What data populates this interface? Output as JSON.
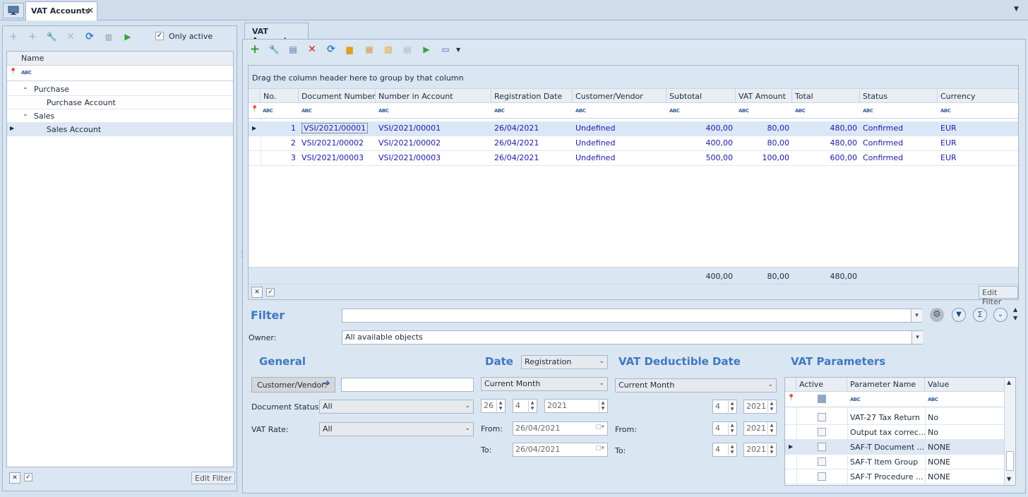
{
  "window": {
    "tab_title": "VAT Accounts"
  },
  "left": {
    "only_active_label": "Only active",
    "only_active_checked": true,
    "column_name": "Name",
    "tree": [
      {
        "label": "Purchase",
        "level": 0
      },
      {
        "label": "Purchase Account",
        "level": 1
      },
      {
        "label": "Sales",
        "level": 0
      },
      {
        "label": "Sales Account",
        "level": 1,
        "selected": true
      }
    ],
    "edit_filter": "Edit Filter"
  },
  "main": {
    "tab_title": "VAT Accounts",
    "group_hint": "Drag the column header here to group by that column",
    "columns": [
      "No.",
      "Document Number",
      "Number in Account",
      "Registration Date",
      "Customer/Vendor",
      "Subtotal",
      "VAT Amount",
      "Total",
      "Status",
      "Currency"
    ],
    "rows": [
      [
        "1",
        "VSI/2021/00001",
        "VSI/2021/00001",
        "26/04/2021",
        "Undefined",
        "400,00",
        "80,00",
        "480,00",
        "Confirmed",
        "EUR"
      ],
      [
        "2",
        "VSI/2021/00002",
        "VSI/2021/00002",
        "26/04/2021",
        "Undefined",
        "400,00",
        "80,00",
        "480,00",
        "Confirmed",
        "EUR"
      ],
      [
        "3",
        "VSI/2021/00003",
        "VSI/2021/00003",
        "26/04/2021",
        "Undefined",
        "500,00",
        "100,00",
        "600,00",
        "Confirmed",
        "EUR"
      ]
    ],
    "totals": {
      "subtotal": "400,00",
      "vat": "80,00",
      "total": "480,00"
    },
    "edit_filter": "Edit Filter"
  },
  "filter": {
    "title": "Filter",
    "owner_label": "Owner:",
    "owner_value": "All available objects",
    "general": {
      "title": "General",
      "customer_button": "Customer/Vendor:",
      "doc_status_label": "Document Status:",
      "doc_status_value": "All",
      "vat_rate_label": "VAT Rate:",
      "vat_rate_value": "All"
    },
    "date": {
      "title": "Date",
      "type_value": "Registration",
      "period_value": "Current Month",
      "day": "26",
      "month": "4",
      "year": "2021",
      "from_label": "From:",
      "from_value": "26/04/2021",
      "to_label": "To:",
      "to_value": "26/04/2021"
    },
    "vat_deductible": {
      "title": "VAT Deductible Date",
      "period_value": "Current Month",
      "month": "4",
      "year": "2021",
      "from_label": "From:",
      "from_month": "4",
      "from_year": "2021",
      "to_label": "To:",
      "to_month": "4",
      "to_year": "2021"
    },
    "vat_params": {
      "title": "VAT Parameters",
      "columns": [
        "Active",
        "Parameter Name",
        "Value"
      ],
      "rows": [
        [
          "VAT-27 Tax Return",
          "No"
        ],
        [
          "Output tax correc...",
          "No"
        ],
        [
          "SAF-T Document ...",
          "NONE"
        ],
        [
          "SAF-T Item Group",
          "NONE"
        ],
        [
          "SAF-T Procedure ...",
          "NONE"
        ]
      ]
    }
  }
}
